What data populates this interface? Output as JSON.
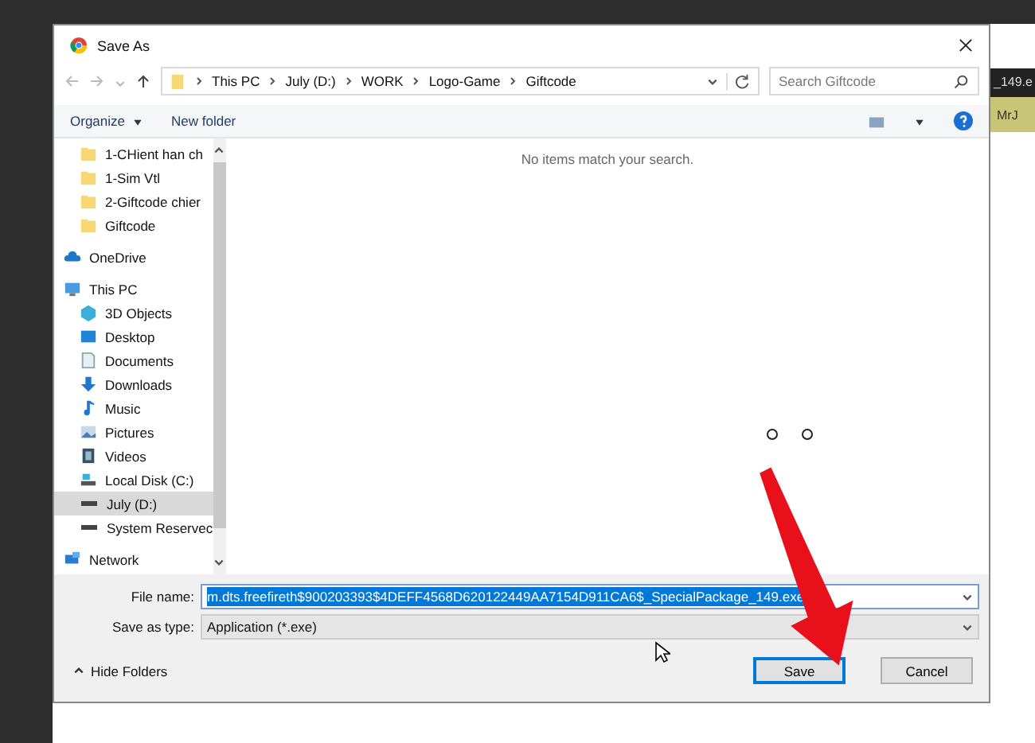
{
  "window": {
    "title": "Save As"
  },
  "address": {
    "crumbs": [
      "This PC",
      "July (D:)",
      "WORK",
      "Logo-Game",
      "Giftcode"
    ],
    "search_placeholder": "Search Giftcode"
  },
  "toolbar": {
    "organize": "Organize",
    "new_folder": "New folder"
  },
  "background_app": {
    "file_tab": "_149.e",
    "tag": "MrJ"
  },
  "sidebar": {
    "pinned": [
      {
        "label": "1-CHient han ch",
        "kind": "folder",
        "selected": false
      },
      {
        "label": "1-Sim Vtl",
        "kind": "folder",
        "selected": false
      },
      {
        "label": "2-Giftcode chier",
        "kind": "folder",
        "selected": false
      },
      {
        "label": "Giftcode",
        "kind": "folder",
        "selected": false
      }
    ],
    "items": [
      {
        "label": "OneDrive",
        "kind": "cloud",
        "selected": false
      },
      {
        "label": "This PC",
        "kind": "pc",
        "selected": false,
        "children": [
          {
            "label": "3D Objects",
            "kind": "cube",
            "selected": false
          },
          {
            "label": "Desktop",
            "kind": "desktop",
            "selected": false
          },
          {
            "label": "Documents",
            "kind": "document",
            "selected": false
          },
          {
            "label": "Downloads",
            "kind": "download",
            "selected": false
          },
          {
            "label": "Music",
            "kind": "music",
            "selected": false
          },
          {
            "label": "Pictures",
            "kind": "picture",
            "selected": false
          },
          {
            "label": "Videos",
            "kind": "video",
            "selected": false
          },
          {
            "label": "Local Disk (C:)",
            "kind": "disk",
            "selected": false
          },
          {
            "label": "July (D:)",
            "kind": "drive",
            "selected": true
          },
          {
            "label": "System Reservec",
            "kind": "drive",
            "selected": false
          }
        ]
      },
      {
        "label": "Network",
        "kind": "network",
        "selected": false
      }
    ]
  },
  "content": {
    "empty_message": "No items match your search."
  },
  "form": {
    "file_name_label": "File name:",
    "file_name": "m.dts.freefireth$900203393$4DEFF4568D620122449AA7154D911CA6$_SpecialPackage_149.exe",
    "file_name_selected": true,
    "type_label": "Save as type:",
    "type_value": "Application (*.exe)"
  },
  "footer": {
    "hide_folders": "Hide Folders",
    "save": "Save",
    "cancel": "Cancel"
  }
}
